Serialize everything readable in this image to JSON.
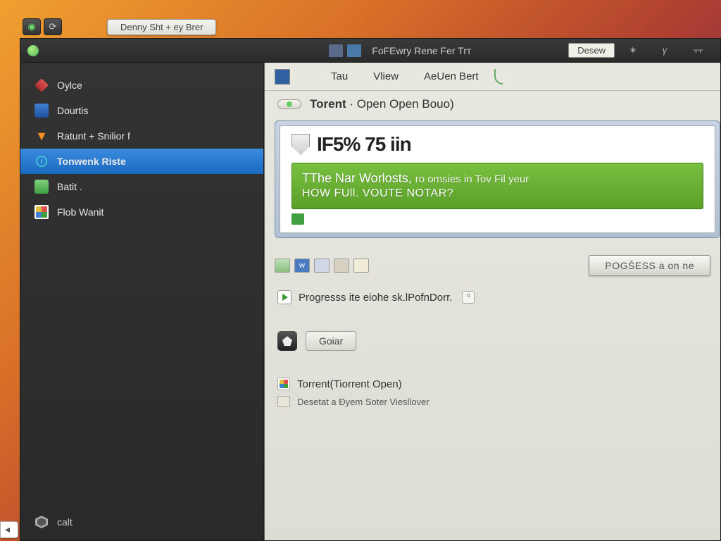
{
  "os": {
    "tab_label": "Denny Sht + ey Brer"
  },
  "titlebar": {
    "center_text": "FoFEwry Rene Fer Trт",
    "right_field": "Desew"
  },
  "sidebar": {
    "items": [
      {
        "label": "Oylce"
      },
      {
        "label": "Dourtis"
      },
      {
        "label": "Ratunt + Snilior f"
      },
      {
        "label": "Tonwenk Riste"
      },
      {
        "label": "Batit ."
      },
      {
        "label": "Flob Wanit"
      }
    ],
    "footer_label": "calt"
  },
  "menubar": {
    "items": [
      "Tau",
      "Vliew",
      "AeUen Bert"
    ]
  },
  "subbar": {
    "title_bold": "Torent",
    "title_rest": "· Open Open Bouo)"
  },
  "panel": {
    "percent_text": "IF5% 75 iin",
    "banner_line1": "TThe Nar Worlosts,",
    "banner_line1b": "ro omsies in Tov Fil yeur",
    "banner_line2": "HOW FUll. VOUTE NOTAR?"
  },
  "actions": {
    "big_button": "POGŠESS a on ne",
    "progress_line": "Progresss ite eiohe sk.lPofnDorr.",
    "small_button": "Goiar"
  },
  "list": {
    "item1": "Torrent(Tiorrent Open)",
    "item2": "Desetat a Đyem Soter Viesllover"
  }
}
